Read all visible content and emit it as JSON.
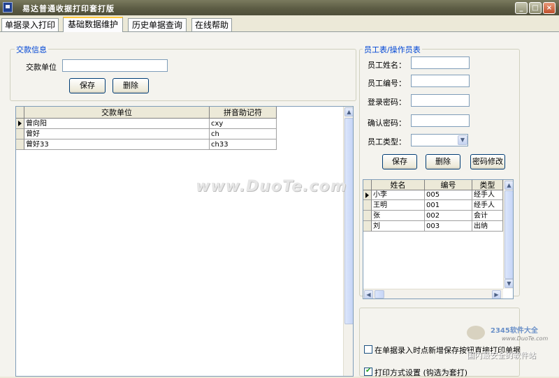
{
  "window": {
    "title": "易达普通收据打印套打版",
    "controls": {
      "minimize": "_",
      "maximize": "□",
      "close": "×"
    }
  },
  "tabs": [
    "单据录入打印",
    "基础数据维护",
    "历史单据查询",
    "在线帮助"
  ],
  "payment": {
    "group_title": "交款信息",
    "unit_label": "交款单位",
    "unit_value": "",
    "save_label": "保存",
    "delete_label": "删除",
    "grid": {
      "columns": [
        "交款单位",
        "拼音助记符"
      ],
      "rows": [
        [
          "曾向阳",
          "cxy"
        ],
        [
          "曾好",
          "ch"
        ],
        [
          "曾好33",
          "ch33"
        ]
      ]
    }
  },
  "employee": {
    "group_title": "员工表/操作员表",
    "name_label": "员工姓名：",
    "number_label": "员工编号：",
    "password_label": "登录密码：",
    "confirm_label": "确认密码：",
    "type_label": "员工类型：",
    "save_label": "保存",
    "delete_label": "删除",
    "password_change_label": "密码修改",
    "grid": {
      "columns": [
        "姓名",
        "编号",
        "类型"
      ],
      "rows": [
        [
          "小李",
          "005",
          "经手人"
        ],
        [
          "王明",
          "001",
          "经手人"
        ],
        [
          "张",
          "002",
          "会计"
        ],
        [
          "刘",
          "003",
          "出纳"
        ]
      ]
    }
  },
  "options": {
    "direct_print_label": "在单据录入时点新增保存按钮直接打印单据",
    "direct_print_checked": false,
    "print_mode_label": "打印方式设置 (钩选为套打)",
    "print_mode_checked": true
  },
  "watermarks": {
    "center": "www.DuoTe.com",
    "logo_text": "2345软件大全",
    "logo_url": "www.DuoTe.com",
    "logo_slogan": "国内最安全的软件站"
  }
}
